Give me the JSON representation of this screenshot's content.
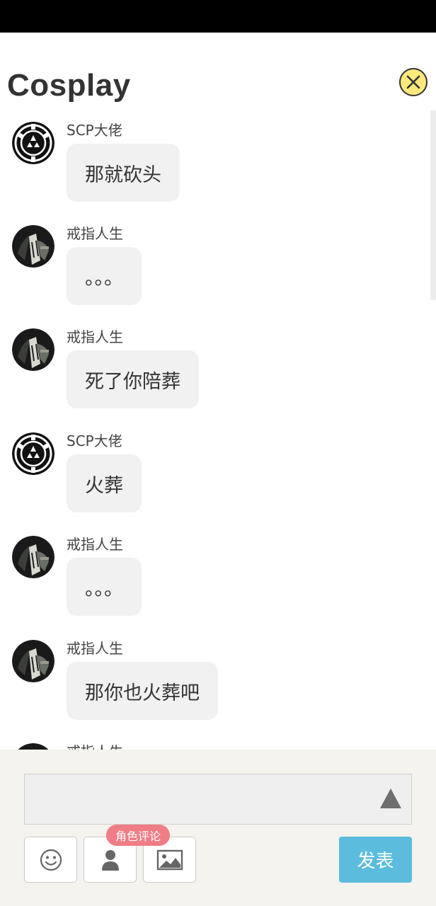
{
  "header": {
    "title": "Cosplay"
  },
  "messages": [
    {
      "sender": "SCP大佬",
      "avatar": "scp-logo",
      "text": "那就砍头"
    },
    {
      "sender": "戒指人生",
      "avatar": "anime-character",
      "text": "。。。"
    },
    {
      "sender": "戒指人生",
      "avatar": "anime-character",
      "text": "死了你陪葬"
    },
    {
      "sender": "SCP大佬",
      "avatar": "scp-logo",
      "text": "火葬"
    },
    {
      "sender": "戒指人生",
      "avatar": "anime-character",
      "text": "。。。"
    },
    {
      "sender": "戒指人生",
      "avatar": "anime-character",
      "text": "那你也火葬吧"
    },
    {
      "sender": "戒指人生",
      "avatar": "anime-character",
      "text": ""
    }
  ],
  "composer": {
    "input_value": "",
    "role_comment_tag": "角色评论",
    "post_label": "发表"
  },
  "colors": {
    "close_button": "#fbe97c",
    "post_button": "#5bbcdd",
    "tag": "#f07d85",
    "bubble": "#f1f1f1",
    "composer_bg": "#f4f3ed"
  }
}
